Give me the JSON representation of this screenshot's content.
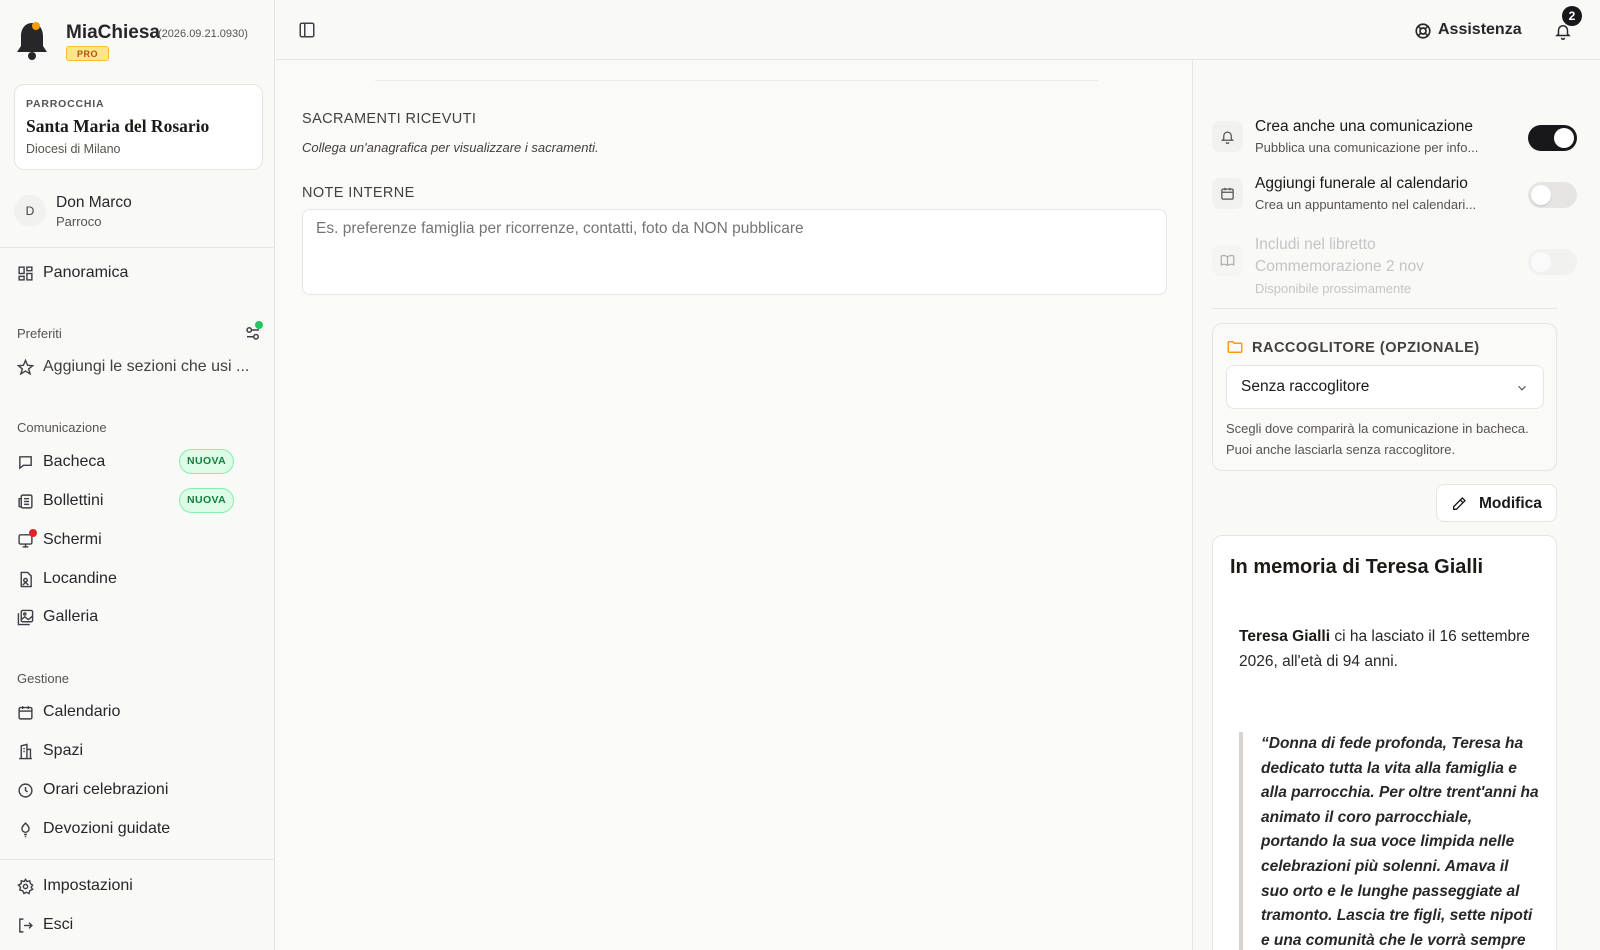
{
  "app": {
    "name": "MiaChiesa",
    "version": "(2026.09.21.0930)",
    "plan_badge": "PRO"
  },
  "parish": {
    "label": "PARROCCHIA",
    "name": "Santa Maria del Rosario",
    "diocese": "Diocesi di Milano"
  },
  "user": {
    "initial": "D",
    "name": "Don Marco",
    "role": "Parroco"
  },
  "nav": {
    "overview": "Panoramica",
    "favorites_title": "Preferiti",
    "favorites_placeholder": "Aggiungi le sezioni che usi ...",
    "communication_title": "Comunicazione",
    "communication": [
      {
        "label": "Bacheca",
        "badge": "NUOVA",
        "icon": "message-icon"
      },
      {
        "label": "Bollettini",
        "badge": "NUOVA",
        "icon": "newspaper-icon"
      },
      {
        "label": "Schermi",
        "badge": "",
        "icon": "monitor-icon",
        "notification_dot": true
      },
      {
        "label": "Locandine",
        "badge": "",
        "icon": "poster-icon"
      },
      {
        "label": "Galleria",
        "badge": "",
        "icon": "gallery-icon"
      }
    ],
    "management_title": "Gestione",
    "management": [
      {
        "label": "Calendario",
        "icon": "calendar-icon"
      },
      {
        "label": "Spazi",
        "icon": "building-icon"
      },
      {
        "label": "Orari celebrazioni",
        "icon": "clock-icon"
      },
      {
        "label": "Devozioni guidate",
        "icon": "candle-icon"
      }
    ],
    "settings": "Impostazioni",
    "logout": "Esci"
  },
  "topbar": {
    "help_label": "Assistenza",
    "notifications_count": "2"
  },
  "main": {
    "sacraments_title": "SACRAMENTI RICEVUTI",
    "sacraments_hint": "Collega un'anagrafica per visualizzare i sacramenti.",
    "notes_title": "NOTE INTERNE",
    "notes_placeholder": "Es. preferenze famiglia per ricorrenze, contatti, foto da NON pubblicare",
    "notes_value": ""
  },
  "panel": {
    "options": [
      {
        "title": "Crea anche una comunicazione",
        "subtitle": "Pubblica una comunicazione per info...",
        "state": "on",
        "icon": "bell-icon"
      },
      {
        "title": "Aggiungi funerale al calendario",
        "subtitle": "Crea un appuntamento nel calendari...",
        "state": "off",
        "icon": "calendar-icon"
      },
      {
        "title_line1": "Includi nel libretto",
        "title_line2": "Commemorazione 2 nov",
        "subtitle": "Disponibile prossimamente",
        "state": "disabled",
        "icon": "book-icon"
      }
    ],
    "folder": {
      "title": "RACCOGLITORE (OPZIONALE)",
      "selected": "Senza raccoglitore",
      "help": "Scegli dove comparirà la comunicazione in bacheca. Puoi anche lasciarla senza raccoglitore."
    },
    "edit_label": "Modifica",
    "preview": {
      "title": "In memoria di Teresa Gialli",
      "body_name": "Teresa Gialli",
      "body_text": " ci ha lasciato il 16 settembre 2026, all'età di 94 anni.",
      "quote": "“Donna di fede profonda, Teresa ha dedicato tutta la vita alla famiglia e alla parrocchia. Per oltre trent'anni ha animato il coro parrocchiale, portando la sua voce limpida nelle celebrazioni più solenni. Amava il suo orto e le lunghe passeggiate al tramonto. Lascia tre figli, sette nipoti e una comunità che le vorrà sempre bene.”"
    }
  },
  "colors": {
    "accent_dark": "#18181b",
    "badge_green": "#15803d",
    "pro_amber": "#b45309",
    "notification_red": "#dc2626",
    "status_green": "#22c55e"
  }
}
